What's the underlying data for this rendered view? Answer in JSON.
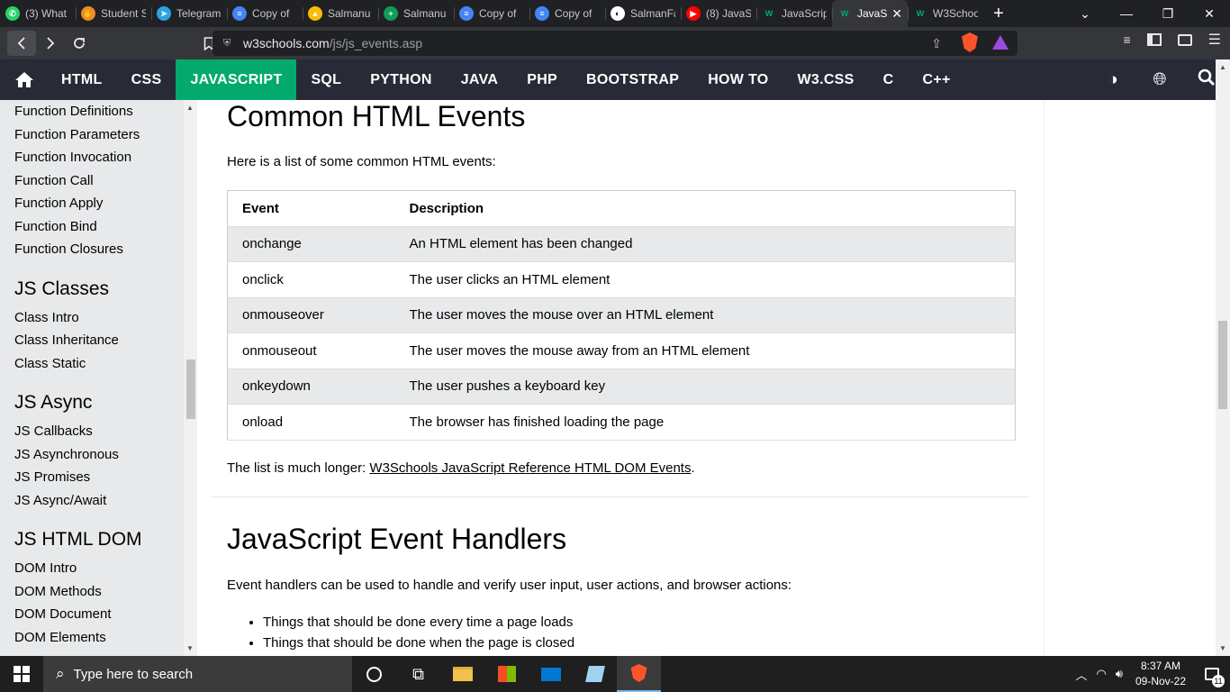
{
  "browser": {
    "tabs": [
      {
        "label": "(3) What",
        "color": "#25d366",
        "glyph": "✆"
      },
      {
        "label": "Student S",
        "color": "#f28b24",
        "glyph": "✋"
      },
      {
        "label": "Telegram",
        "color": "#2aa3e0",
        "glyph": "➤"
      },
      {
        "label": "Copy of",
        "color": "#4285f4",
        "glyph": "≡"
      },
      {
        "label": "Salmanu",
        "color": "#fbbc04",
        "glyph": "▲"
      },
      {
        "label": "Salmanu",
        "color": "#0f9d58",
        "glyph": "+"
      },
      {
        "label": "Copy of",
        "color": "#4285f4",
        "glyph": "≡"
      },
      {
        "label": "Copy of",
        "color": "#4285f4",
        "glyph": "≡"
      },
      {
        "label": "SalmanFa",
        "color": "#ffffff",
        "glyph": "◐"
      },
      {
        "label": "(8) JavaS",
        "color": "#ff0000",
        "glyph": "▶"
      },
      {
        "label": "JavaScrip",
        "color": "#04aa6d",
        "glyph": "W"
      },
      {
        "label": "JavaS",
        "color": "#04aa6d",
        "glyph": "W",
        "active": true
      },
      {
        "label": "W3Schoo",
        "color": "#04aa6d",
        "glyph": "W"
      }
    ],
    "url_host": "w3schools.com",
    "url_path": "/js/js_events.asp"
  },
  "topnav": {
    "items": [
      "HTML",
      "CSS",
      "JAVASCRIPT",
      "SQL",
      "PYTHON",
      "JAVA",
      "PHP",
      "BOOTSTRAP",
      "HOW TO",
      "W3.CSS",
      "C",
      "C++"
    ],
    "active": "JAVASCRIPT"
  },
  "sidebar": {
    "groups": [
      {
        "heading": "",
        "links": [
          "Function Definitions",
          "Function Parameters",
          "Function Invocation",
          "Function Call",
          "Function Apply",
          "Function Bind",
          "Function Closures"
        ]
      },
      {
        "heading": "JS Classes",
        "links": [
          "Class Intro",
          "Class Inheritance",
          "Class Static"
        ]
      },
      {
        "heading": "JS Async",
        "links": [
          "JS Callbacks",
          "JS Asynchronous",
          "JS Promises",
          "JS Async/Await"
        ]
      },
      {
        "heading": "JS HTML DOM",
        "links": [
          "DOM Intro",
          "DOM Methods",
          "DOM Document",
          "DOM Elements"
        ]
      }
    ]
  },
  "content": {
    "section1_title": "Common HTML Events",
    "section1_intro": "Here is a list of some common HTML events:",
    "table_headers": [
      "Event",
      "Description"
    ],
    "events": [
      {
        "event": "onchange",
        "description": "An HTML element has been changed"
      },
      {
        "event": "onclick",
        "description": "The user clicks an HTML element"
      },
      {
        "event": "onmouseover",
        "description": "The user moves the mouse over an HTML element"
      },
      {
        "event": "onmouseout",
        "description": "The user moves the mouse away from an HTML element"
      },
      {
        "event": "onkeydown",
        "description": "The user pushes a keyboard key"
      },
      {
        "event": "onload",
        "description": "The browser has finished loading the page"
      }
    ],
    "list_note_prefix": "The list is much longer: ",
    "list_note_link": "W3Schools JavaScript Reference HTML DOM Events",
    "list_note_suffix": ".",
    "section2_title": "JavaScript Event Handlers",
    "section2_intro": "Event handlers can be used to handle and verify user input, user actions, and browser actions:",
    "bullets": [
      "Things that should be done every time a page loads",
      "Things that should be done when the page is closed"
    ]
  },
  "taskbar": {
    "search_placeholder": "Type here to search",
    "time": "8:37 AM",
    "date": "09-Nov-22",
    "notification_count": "11"
  }
}
